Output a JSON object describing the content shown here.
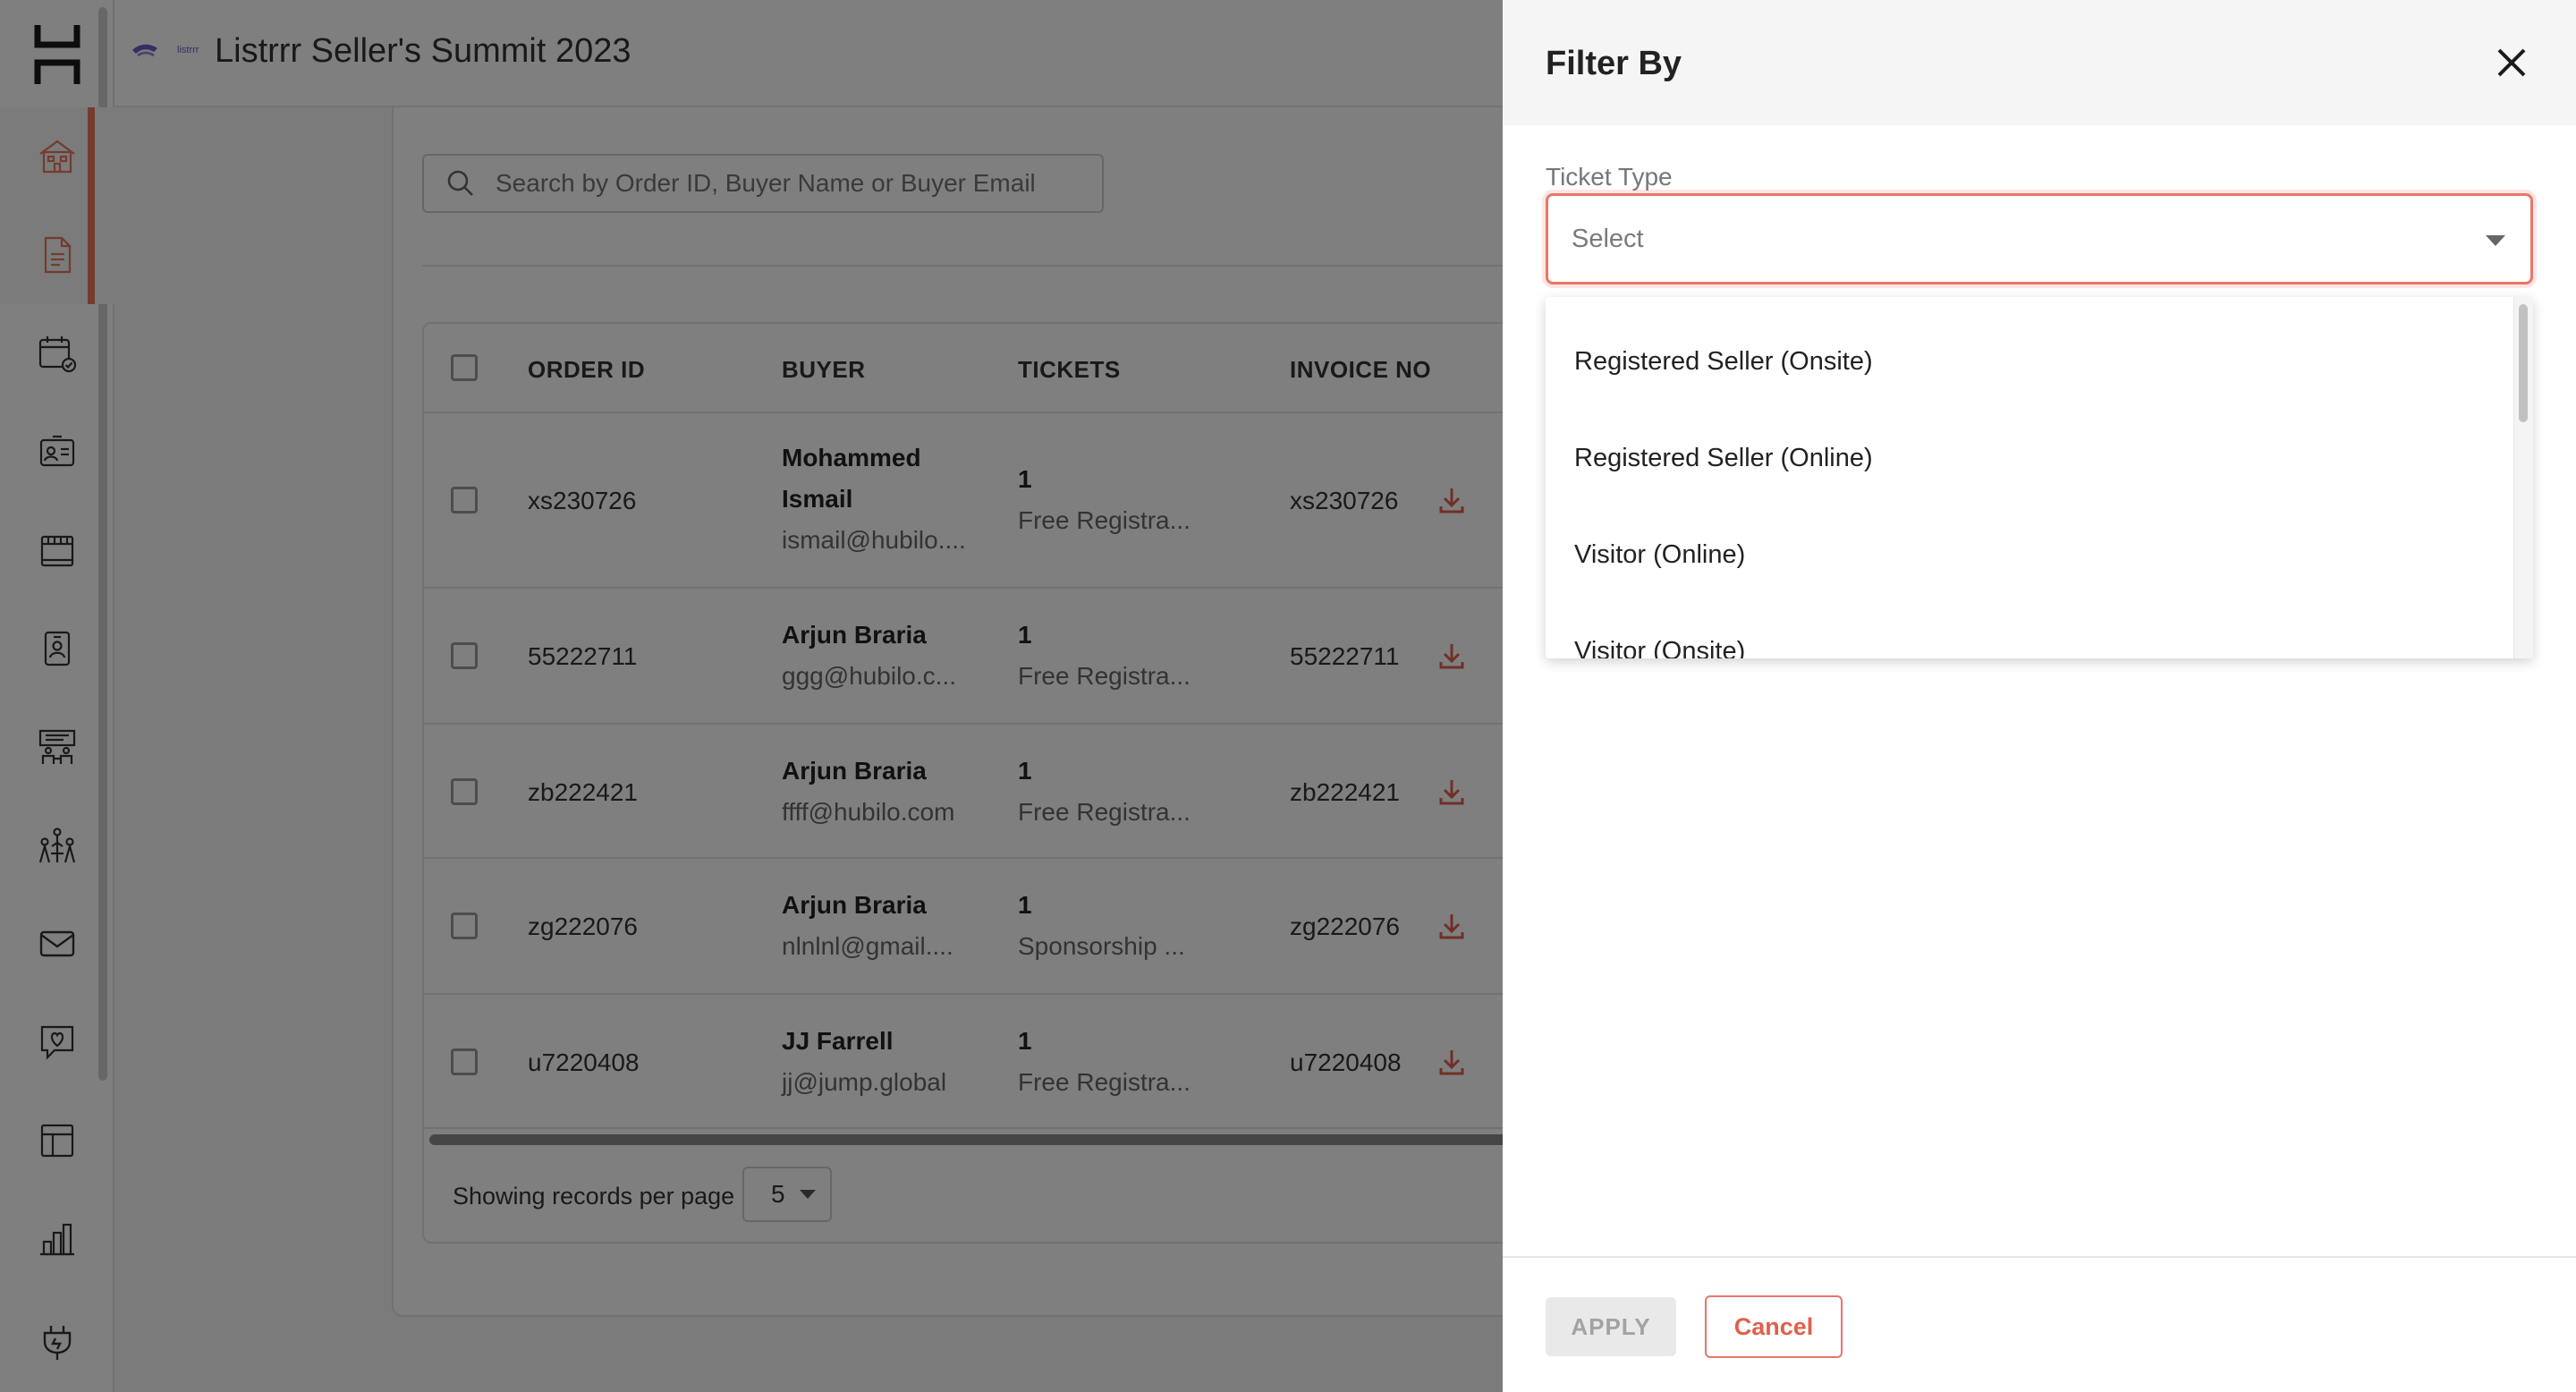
{
  "app": {
    "logo_icon": "hubilo-logo",
    "brand_icon": "listrrr-logo",
    "brand_logo_text": "listrrr",
    "event_title": "Listrrr Seller's Summit 2023",
    "accent_color": "#e8765c"
  },
  "sidebar": {
    "items": [
      {
        "icon": "building-icon",
        "active": true
      },
      {
        "icon": "document-icon",
        "active": true
      },
      {
        "icon": "calendar-check-icon",
        "active": false
      },
      {
        "icon": "id-card-icon",
        "active": false
      },
      {
        "icon": "booth-icon",
        "active": false
      },
      {
        "icon": "badge-icon",
        "active": false
      },
      {
        "icon": "meeting-room-icon",
        "active": false
      },
      {
        "icon": "networking-icon",
        "active": false
      },
      {
        "icon": "mail-icon",
        "active": false
      },
      {
        "icon": "chat-heart-icon",
        "active": false
      },
      {
        "icon": "layout-icon",
        "active": false
      },
      {
        "icon": "analytics-icon",
        "active": false
      },
      {
        "icon": "plug-icon",
        "active": false
      }
    ]
  },
  "search": {
    "placeholder": "Search by Order ID, Buyer Name or Buyer Email"
  },
  "table": {
    "columns": [
      "ORDER ID",
      "BUYER",
      "TICKETS",
      "INVOICE NO"
    ],
    "rows": [
      {
        "order_id": "xs230726",
        "buyer_name_line1": "Mohammed",
        "buyer_name_line2": "Ismail",
        "buyer_email": "ismail@hubilo....",
        "ticket_count": "1",
        "ticket_type": "Free Registra...",
        "invoice_no": "xs230726"
      },
      {
        "order_id": "55222711",
        "buyer_name_line1": "Arjun Braria",
        "buyer_email": "ggg@hubilo.c...",
        "ticket_count": "1",
        "ticket_type": "Free Registra...",
        "invoice_no": "55222711"
      },
      {
        "order_id": "zb222421",
        "buyer_name_line1": "Arjun Braria",
        "buyer_email": "ffff@hubilo.com",
        "ticket_count": "1",
        "ticket_type": "Free Registra...",
        "invoice_no": "zb222421"
      },
      {
        "order_id": "zg222076",
        "buyer_name_line1": "Arjun Braria",
        "buyer_email": "nlnlnl@gmail....",
        "ticket_count": "1",
        "ticket_type": "Sponsorship ...",
        "invoice_no": "zg222076"
      },
      {
        "order_id": "u7220408",
        "buyer_name_line1": "JJ Farrell",
        "buyer_email": "jj@jump.global",
        "ticket_count": "1",
        "ticket_type": "Free Registra...",
        "invoice_no": "u7220408"
      }
    ]
  },
  "pagination": {
    "label": "Showing records per page",
    "per_page": "5"
  },
  "filter_drawer": {
    "title": "Filter By",
    "ticket_type_label": "Ticket Type",
    "select_placeholder": "Select",
    "options": [
      "Registered Seller (Onsite)",
      "Registered Seller (Online)",
      "Visitor (Online)",
      "Visitor (Onsite)"
    ],
    "apply_label": "APPLY",
    "cancel_label": "Cancel"
  }
}
